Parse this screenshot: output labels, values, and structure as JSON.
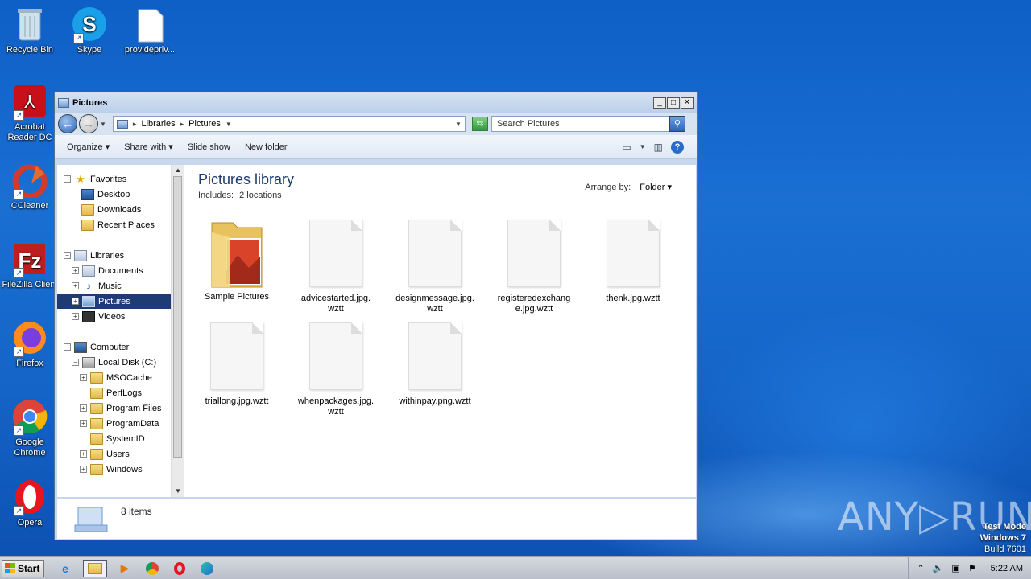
{
  "desktop": {
    "icons": [
      {
        "label": "Recycle Bin"
      },
      {
        "label": "Skype"
      },
      {
        "label": "providepriv..."
      },
      {
        "label": "Acrobat Reader DC"
      },
      {
        "label": "CCleaner"
      },
      {
        "label": "FileZilla Client"
      },
      {
        "label": "Firefox"
      },
      {
        "label": "Google Chrome"
      },
      {
        "label": "Opera"
      }
    ],
    "watermark": "ANY▷RUN",
    "test_mode": {
      "line1": "Test Mode",
      "line2": "Windows 7",
      "line3": "Build 7601"
    }
  },
  "window": {
    "title": "Pictures",
    "buttons": {
      "minimize": "_",
      "maximize": "□",
      "close": "✕"
    },
    "address": {
      "segments": [
        "Libraries",
        "Pictures"
      ],
      "sep": "▸"
    },
    "search_placeholder": "Search Pictures",
    "toolbar": {
      "organize": "Organize ▾",
      "share_with": "Share with ▾",
      "slide_show": "Slide show",
      "new_folder": "New folder"
    },
    "nav": {
      "favorites": "Favorites",
      "desktop": "Desktop",
      "downloads": "Downloads",
      "recent_places": "Recent Places",
      "libraries": "Libraries",
      "documents": "Documents",
      "music": "Music",
      "pictures": "Pictures",
      "videos": "Videos",
      "computer": "Computer",
      "local_disk": "Local Disk (C:)",
      "folders": [
        "MSOCache",
        "PerfLogs",
        "Program Files",
        "ProgramData",
        "SystemID",
        "Users",
        "Windows"
      ]
    },
    "content": {
      "title": "Pictures library",
      "includes_label": "Includes:",
      "includes_value": "2 locations",
      "arrange_label": "Arrange by:",
      "arrange_value": "Folder ▾",
      "items": [
        {
          "name": "Sample Pictures"
        },
        {
          "name": "advicestarted.jpg.wztt"
        },
        {
          "name": "designmessage.jpg.wztt"
        },
        {
          "name": "registeredexchange.jpg.wztt"
        },
        {
          "name": "thenk.jpg.wztt"
        },
        {
          "name": "triallong.jpg.wztt"
        },
        {
          "name": "whenpackages.jpg.wztt"
        },
        {
          "name": "withinpay.png.wztt"
        }
      ]
    },
    "details": {
      "count": "8 items"
    }
  },
  "taskbar": {
    "start": "Start",
    "clock": "5:22 AM"
  }
}
